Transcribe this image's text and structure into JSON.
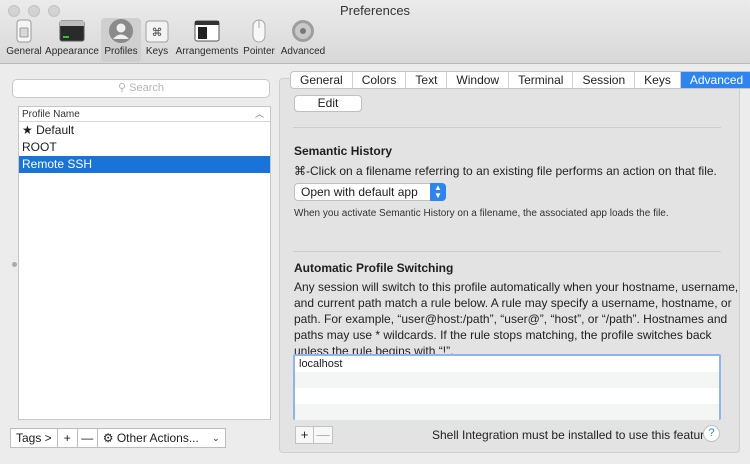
{
  "window": {
    "title": "Preferences"
  },
  "toolbar": {
    "items": [
      {
        "label": "General",
        "icon": "general-switch-icon"
      },
      {
        "label": "Appearance",
        "icon": "appearance-window-icon"
      },
      {
        "label": "Profiles",
        "icon": "profile-person-icon",
        "active": true
      },
      {
        "label": "Keys",
        "icon": "command-key-icon"
      },
      {
        "label": "Arrangements",
        "icon": "arrangements-windows-icon"
      },
      {
        "label": "Pointer",
        "icon": "mouse-pointer-icon"
      },
      {
        "label": "Advanced",
        "icon": "gear-icon"
      }
    ]
  },
  "left": {
    "search_placeholder": "Search",
    "column_header": "Profile Name",
    "profiles": [
      {
        "name": "★ Default",
        "selected": false
      },
      {
        "name": "ROOT",
        "selected": false
      },
      {
        "name": "Remote SSH",
        "selected": true
      }
    ],
    "tags_button": "Tags >",
    "add_button": "+",
    "remove_button": "—",
    "other_actions": "Other Actions..."
  },
  "tabs": [
    "General",
    "Colors",
    "Text",
    "Window",
    "Terminal",
    "Session",
    "Keys",
    "Advanced"
  ],
  "active_tab": "Advanced",
  "edit_button": "Edit",
  "semantic_history": {
    "title": "Semantic History",
    "description": "⌘-Click on a filename referring to an existing file performs an action on that file.",
    "selected_option": "Open with default app",
    "note": "When you activate Semantic History on a filename, the associated app loads the file."
  },
  "auto_switching": {
    "title": "Automatic Profile Switching",
    "description_lines": [
      "Any session will switch to this profile automatically when your hostname, username,",
      "and current path match a rule below. A rule may specify a username, hostname, or",
      "path. For example, “user@host:/path”, “user@”, “host”, or “/path”. Hostnames and",
      "paths may use * wildcards. If the rule stops matching, the profile switches back",
      "unless the rule begins with “!”."
    ],
    "rules": [
      "localhost",
      "",
      "",
      ""
    ],
    "add_rule": "+",
    "remove_rule": "—"
  },
  "footer_note": "Shell Integration must be installed to use this feature.",
  "help": "?",
  "colors": {
    "accent": "#2f85ef",
    "selection": "#1a73d9"
  }
}
